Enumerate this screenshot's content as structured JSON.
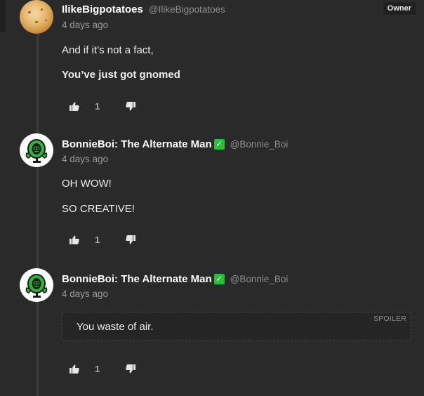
{
  "comments": [
    {
      "author": "IlikeBigpotatoes",
      "handle": "@IlikeBigpotatoes",
      "time": "4 days ago",
      "badge": "Owner",
      "avatar": "potato-avatar",
      "lines": [
        "And if it’s not a fact,",
        "You’ve just got gnomed"
      ],
      "likes": "1"
    },
    {
      "author": "BonnieBoi: The Alternate Man",
      "verified_icon": "check-badge-icon",
      "handle": "@Bonnie_Boi",
      "time": "4 days ago",
      "avatar": "robot-avatar",
      "lines": [
        "OH WOW!",
        "SO CREATIVE!"
      ],
      "likes": "1"
    },
    {
      "author": "BonnieBoi: The Alternate Man",
      "verified_icon": "check-badge-icon",
      "handle": "@Bonnie_Boi",
      "time": "4 days ago",
      "avatar": "robot-avatar",
      "spoiler": {
        "label": "SPOILER",
        "text": "You waste of air."
      },
      "likes": "1"
    }
  ],
  "colors": {
    "background": "#2a2a2a",
    "verified": "#2ebd3a",
    "robot_green": "#2fb53a"
  }
}
